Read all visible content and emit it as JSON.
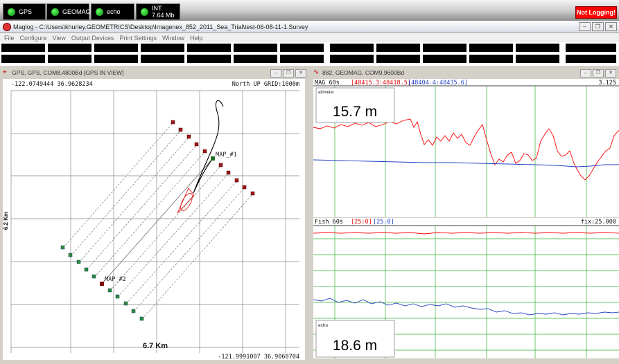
{
  "status_bar": {
    "indicators": [
      {
        "label": "GPS",
        "sub": "",
        "state": "green"
      },
      {
        "label": "GEOMAG",
        "sub": "",
        "state": "green"
      },
      {
        "label": "echo",
        "sub": "",
        "state": "green"
      },
      {
        "label": "INT",
        "sub": "7.64 Mb",
        "state": "green"
      }
    ],
    "logging": "Not Logging!"
  },
  "window": {
    "title": "Maglog - C:\\Users\\khurley.GEOMETRICS\\Desktop\\Imagenex_852_2011_Sea_Trial\\test-06-08-11-1.Survey",
    "controls": [
      "minimize",
      "maximize",
      "close"
    ]
  },
  "menu": [
    "File",
    "Configure",
    "View",
    "Output Devices",
    "Print Settings",
    "Window",
    "Help"
  ],
  "gps_pane": {
    "title": "GPS, GPS, COM8,4800Bd [GPS IN VIEW]",
    "top_left_coord": "-122.0749444 36.9628234",
    "top_right_info": "North UP GRID:1000m",
    "bottom_right_coord": "-121.9991007 36.9068704",
    "y_scale": "6.2 Km",
    "x_scale": "6.7 Km",
    "markers": [
      {
        "label": "MAP_#1",
        "color": "#1e6e1e"
      },
      {
        "label": "MAP_#2",
        "color": "#800000"
      }
    ],
    "colors": {
      "start_points": "#2e8b3a",
      "end_points": "#a01818",
      "track": "#000000",
      "vessel": "#e02020"
    }
  },
  "mag_pane": {
    "title": "882, GEOMAG, COM9,9600Bd",
    "header_label": "MAG  60s",
    "range1": "[48415.3:48418.5]",
    "range2": "[48404.4:48435.6]",
    "right_value": "3.125",
    "altimeter_label": "altimeter",
    "altimeter_value": "15.7 m",
    "colors": {
      "series1": "#ff0000",
      "series2": "#2040c0",
      "grid": "#30b030"
    }
  },
  "fish_pane": {
    "header_label": "Fish  60s",
    "range1": "[25:0]",
    "range2": "[25:0]",
    "right_value": "fix:25.000",
    "echo_label": "echo",
    "echo_value": "18.6 m"
  }
}
